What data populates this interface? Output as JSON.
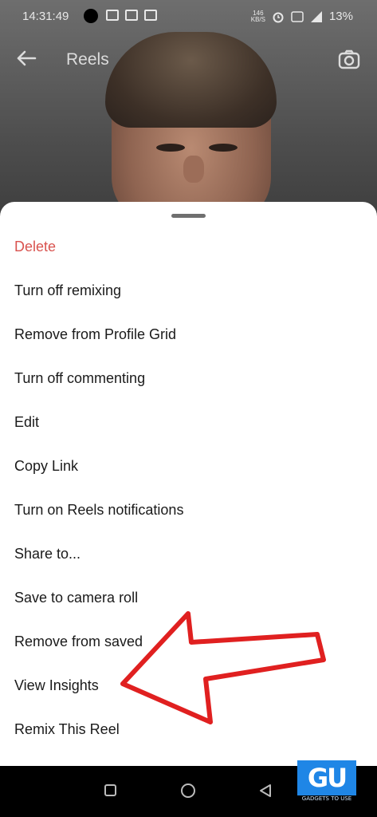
{
  "status_bar": {
    "time": "14:31:49",
    "net_speed": "146\nKB/S",
    "battery": "13%"
  },
  "topbar": {
    "title": "Reels"
  },
  "sheet": {
    "menu": [
      {
        "label": "Delete",
        "color": "#d9534f"
      },
      {
        "label": "Turn off remixing"
      },
      {
        "label": "Remove from Profile Grid"
      },
      {
        "label": "Turn off commenting"
      },
      {
        "label": "Edit"
      },
      {
        "label": "Copy Link"
      },
      {
        "label": "Turn on Reels notifications"
      },
      {
        "label": "Share to..."
      },
      {
        "label": "Save to camera roll"
      },
      {
        "label": "Remove from saved"
      },
      {
        "label": "View Insights"
      },
      {
        "label": "Remix This Reel"
      }
    ]
  },
  "annotation": {
    "arrow_color": "#e02020"
  },
  "watermark": {
    "logo": "GU",
    "tagline": "GADGETS TO USE"
  }
}
